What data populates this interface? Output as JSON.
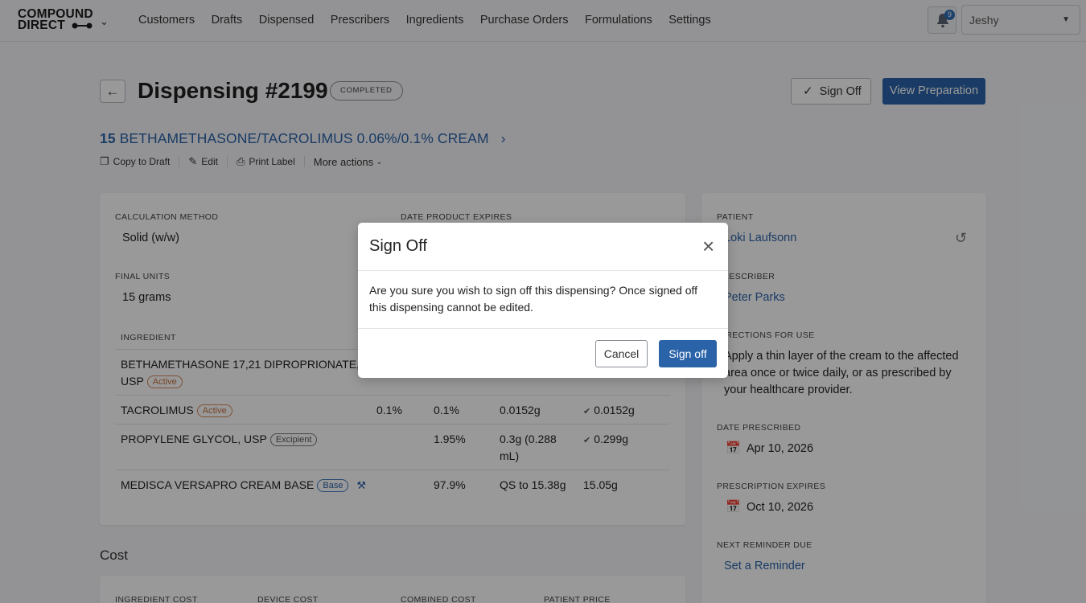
{
  "app": {
    "logo_line1": "COMPOUND",
    "logo_line2": "DIRECT",
    "nav": [
      "Customers",
      "Drafts",
      "Dispensed",
      "Prescribers",
      "Ingredients",
      "Purchase Orders",
      "Formulations",
      "Settings"
    ],
    "notification_count": "9",
    "user": "Jeshy"
  },
  "header": {
    "title": "Dispensing #2199",
    "status": "COMPLETED",
    "signoff_label": "Sign Off",
    "view_prep_label": "View Preparation",
    "rx_qty": "15",
    "rx_name": "BETHAMETHASONE/TACROLIMUS 0.06%/0.1% CREAM",
    "actions": {
      "copy": "Copy to Draft",
      "edit": "Edit",
      "print": "Print Label",
      "more": "More actions"
    }
  },
  "details": {
    "calc_method_label": "CALCULATION METHOD",
    "calc_method": "Solid (w/w)",
    "date_expires_label": "DATE PRODUCT EXPIRES",
    "final_units_label": "FINAL UNITS",
    "final_units": "15 grams",
    "ingredient_header": "INGREDIENT",
    "ingredients": [
      {
        "name": "BETHAMETHASONE 17,21 DIPROPRIONATE,",
        "name2": "USP",
        "tag": "Active",
        "c1": "",
        "c2": "",
        "c3": "",
        "c4": ""
      },
      {
        "name": "TACROLIMUS",
        "tag": "Active",
        "c1": "0.1%",
        "c2": "0.1%",
        "c3": "0.0152g",
        "c4": "0.0152g"
      },
      {
        "name": "PROPYLENE GLYCOL, USP",
        "tag": "Excipient",
        "c1": "",
        "c2": "1.95%",
        "c3": "0.3g (0.288",
        "c3b": "mL)",
        "c4": "0.299g"
      },
      {
        "name": "MEDISCA VERSAPRO CREAM BASE",
        "tag": "Base",
        "c1": "",
        "c2": "97.9%",
        "c3": "QS to 15.38g",
        "c4": "15.05g"
      }
    ]
  },
  "cost": {
    "title": "Cost",
    "labels": [
      "INGREDIENT COST",
      "DEVICE COST",
      "COMBINED COST",
      "PATIENT PRICE"
    ]
  },
  "side": {
    "patient_label": "PATIENT",
    "patient": "Loki Laufsonn",
    "prescriber_label": "PRESCRIBER",
    "prescriber": "Peter Parks",
    "directions_label": "DIRECTIONS FOR USE",
    "directions": "Apply a thin layer of the cream to the affected area once or twice daily, or as prescribed by your healthcare provider.",
    "date_prescribed_label": "DATE PRESCRIBED",
    "date_prescribed": "Apr 10, 2026",
    "rx_expires_label": "PRESCRIPTION EXPIRES",
    "rx_expires": "Oct 10, 2026",
    "reminder_label": "NEXT REMINDER DUE",
    "reminder_link": "Set a Reminder"
  },
  "modal": {
    "title": "Sign Off",
    "body": "Are you sure you wish to sign off this dispensing? Once signed off this dispensing cannot be edited.",
    "cancel": "Cancel",
    "confirm": "Sign off"
  }
}
